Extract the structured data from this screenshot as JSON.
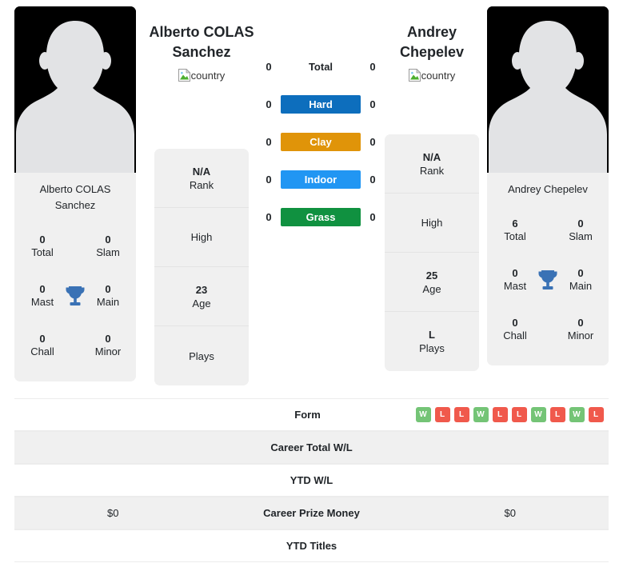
{
  "players": {
    "left": {
      "header_name": "Alberto COLAS Sanchez",
      "header_name_line1": "Alberto COLAS",
      "header_name_line2": "Sanchez",
      "country_alt": "country",
      "card_name": "Alberto COLAS Sanchez",
      "titles": [
        {
          "value": "0",
          "label": "Total"
        },
        {
          "value": "0",
          "label": "Slam"
        },
        {
          "value": "0",
          "label": "Mast"
        },
        {
          "value": "0",
          "label": "Main"
        },
        {
          "value": "0",
          "label": "Chall"
        },
        {
          "value": "0",
          "label": "Minor"
        }
      ],
      "info": [
        {
          "value": "N/A",
          "label": "Rank"
        },
        {
          "value": "",
          "label": "High"
        },
        {
          "value": "23",
          "label": "Age"
        },
        {
          "value": "",
          "label": "Plays"
        }
      ],
      "surface_values": [
        "0",
        "0",
        "0",
        "0",
        "0"
      ],
      "form": [],
      "career_total_wl": "",
      "ytd_wl": "",
      "career_prize_money": "$0",
      "ytd_titles": ""
    },
    "right": {
      "header_name": "Andrey Chepelev",
      "header_name_line1": "Andrey",
      "header_name_line2": "Chepelev",
      "country_alt": "country",
      "card_name": "Andrey Chepelev",
      "titles": [
        {
          "value": "6",
          "label": "Total"
        },
        {
          "value": "0",
          "label": "Slam"
        },
        {
          "value": "0",
          "label": "Mast"
        },
        {
          "value": "0",
          "label": "Main"
        },
        {
          "value": "0",
          "label": "Chall"
        },
        {
          "value": "0",
          "label": "Minor"
        }
      ],
      "info": [
        {
          "value": "N/A",
          "label": "Rank"
        },
        {
          "value": "",
          "label": "High"
        },
        {
          "value": "25",
          "label": "Age"
        },
        {
          "value": "L",
          "label": "Plays"
        }
      ],
      "surface_values": [
        "0",
        "0",
        "0",
        "0",
        "0"
      ],
      "form": [
        "W",
        "L",
        "L",
        "W",
        "L",
        "L",
        "W",
        "L",
        "W",
        "L"
      ],
      "career_total_wl": "",
      "ytd_wl": "",
      "career_prize_money": "$0",
      "ytd_titles": ""
    }
  },
  "surfaces": [
    {
      "label": "Total",
      "color": "transparent",
      "plain": true
    },
    {
      "label": "Hard",
      "color": "#0d6ebd"
    },
    {
      "label": "Clay",
      "color": "#e09409"
    },
    {
      "label": "Indoor",
      "color": "#2196f3"
    },
    {
      "label": "Grass",
      "color": "#109140"
    }
  ],
  "stat_rows": [
    {
      "label": "Form"
    },
    {
      "label": "Career Total W/L"
    },
    {
      "label": "YTD W/L"
    },
    {
      "label": "Career Prize Money"
    },
    {
      "label": "YTD Titles"
    }
  ],
  "colors": {
    "hard": "#0d6ebd",
    "clay": "#e09409",
    "indoor": "#2196f3",
    "grass": "#109140",
    "win": "#74c476",
    "loss": "#f0594c",
    "trophy": "#3a72b5",
    "card_bg": "#f0f0f0",
    "page_bg": "#ffffff"
  }
}
